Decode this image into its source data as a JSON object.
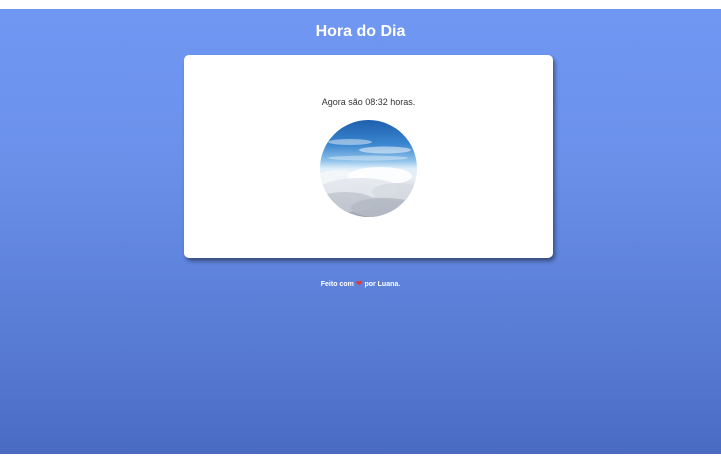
{
  "header": {
    "title": "Hora do Dia"
  },
  "card": {
    "time_message": "Agora são 08:32 horas.",
    "image_icon": "sky-clouds-morning-image"
  },
  "footer": {
    "prefix": "Feito com",
    "icon": "heart-icon",
    "suffix": "por Luana."
  },
  "colors": {
    "background_top": "#7098f3",
    "background_bottom": "#4b6bc3",
    "card": "#ffffff",
    "heart": "#e53935"
  }
}
